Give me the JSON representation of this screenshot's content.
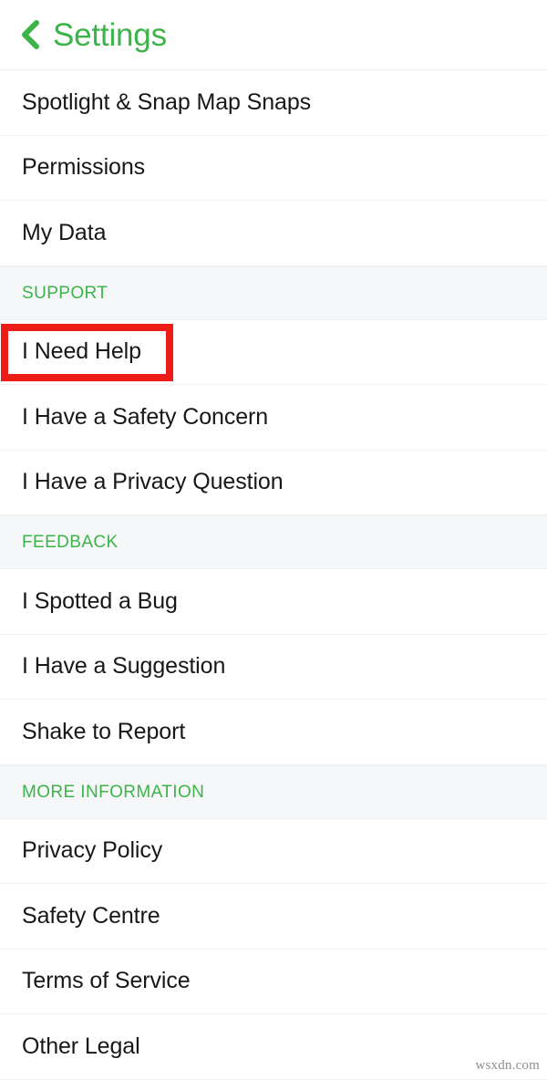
{
  "header": {
    "back_icon": "chevron-left-icon",
    "title": "Settings",
    "accent_color": "#3cb44a"
  },
  "list": {
    "items": [
      {
        "type": "row",
        "label": "Spotlight & Snap Map Snaps",
        "highlighted": false
      },
      {
        "type": "row",
        "label": "Permissions",
        "highlighted": false
      },
      {
        "type": "row",
        "label": "My Data",
        "highlighted": false
      },
      {
        "type": "section",
        "label": "SUPPORT"
      },
      {
        "type": "row",
        "label": "I Need Help",
        "highlighted": true
      },
      {
        "type": "row",
        "label": "I Have a Safety Concern",
        "highlighted": false
      },
      {
        "type": "row",
        "label": "I Have a Privacy Question",
        "highlighted": false
      },
      {
        "type": "section",
        "label": "FEEDBACK"
      },
      {
        "type": "row",
        "label": "I Spotted a Bug",
        "highlighted": false
      },
      {
        "type": "row",
        "label": "I Have a Suggestion",
        "highlighted": false
      },
      {
        "type": "row",
        "label": "Shake to Report",
        "highlighted": false
      },
      {
        "type": "section",
        "label": "MORE INFORMATION"
      },
      {
        "type": "row",
        "label": "Privacy Policy",
        "highlighted": false
      },
      {
        "type": "row",
        "label": "Safety Centre",
        "highlighted": false
      },
      {
        "type": "row",
        "label": "Terms of Service",
        "highlighted": false
      },
      {
        "type": "row",
        "label": "Other Legal",
        "highlighted": false
      }
    ]
  },
  "annotation": {
    "highlight_color": "#ee1c16",
    "target_label": "I Need Help"
  },
  "watermark": {
    "text": "wsxdn.com"
  }
}
